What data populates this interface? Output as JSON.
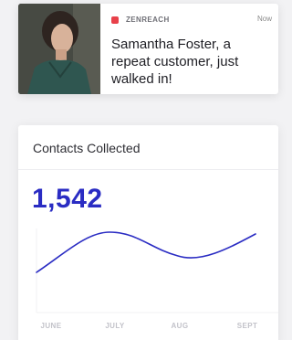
{
  "notification": {
    "app_name": "ZENREACH",
    "time": "Now",
    "message": "Samantha Foster, a repeat customer, just walked in!",
    "brand_color": "#e8414a"
  },
  "contacts_card": {
    "title": "Contacts Collected",
    "total": "1,542",
    "accent_color": "#2a2cc3"
  },
  "chart_data": {
    "type": "line",
    "categories": [
      "JUNE",
      "JULY",
      "AUG",
      "SEPT"
    ],
    "title": "",
    "xlabel": "",
    "ylabel": "",
    "grid": false,
    "legend": "none",
    "series": [
      {
        "color": "#2a2cc3"
      }
    ]
  }
}
